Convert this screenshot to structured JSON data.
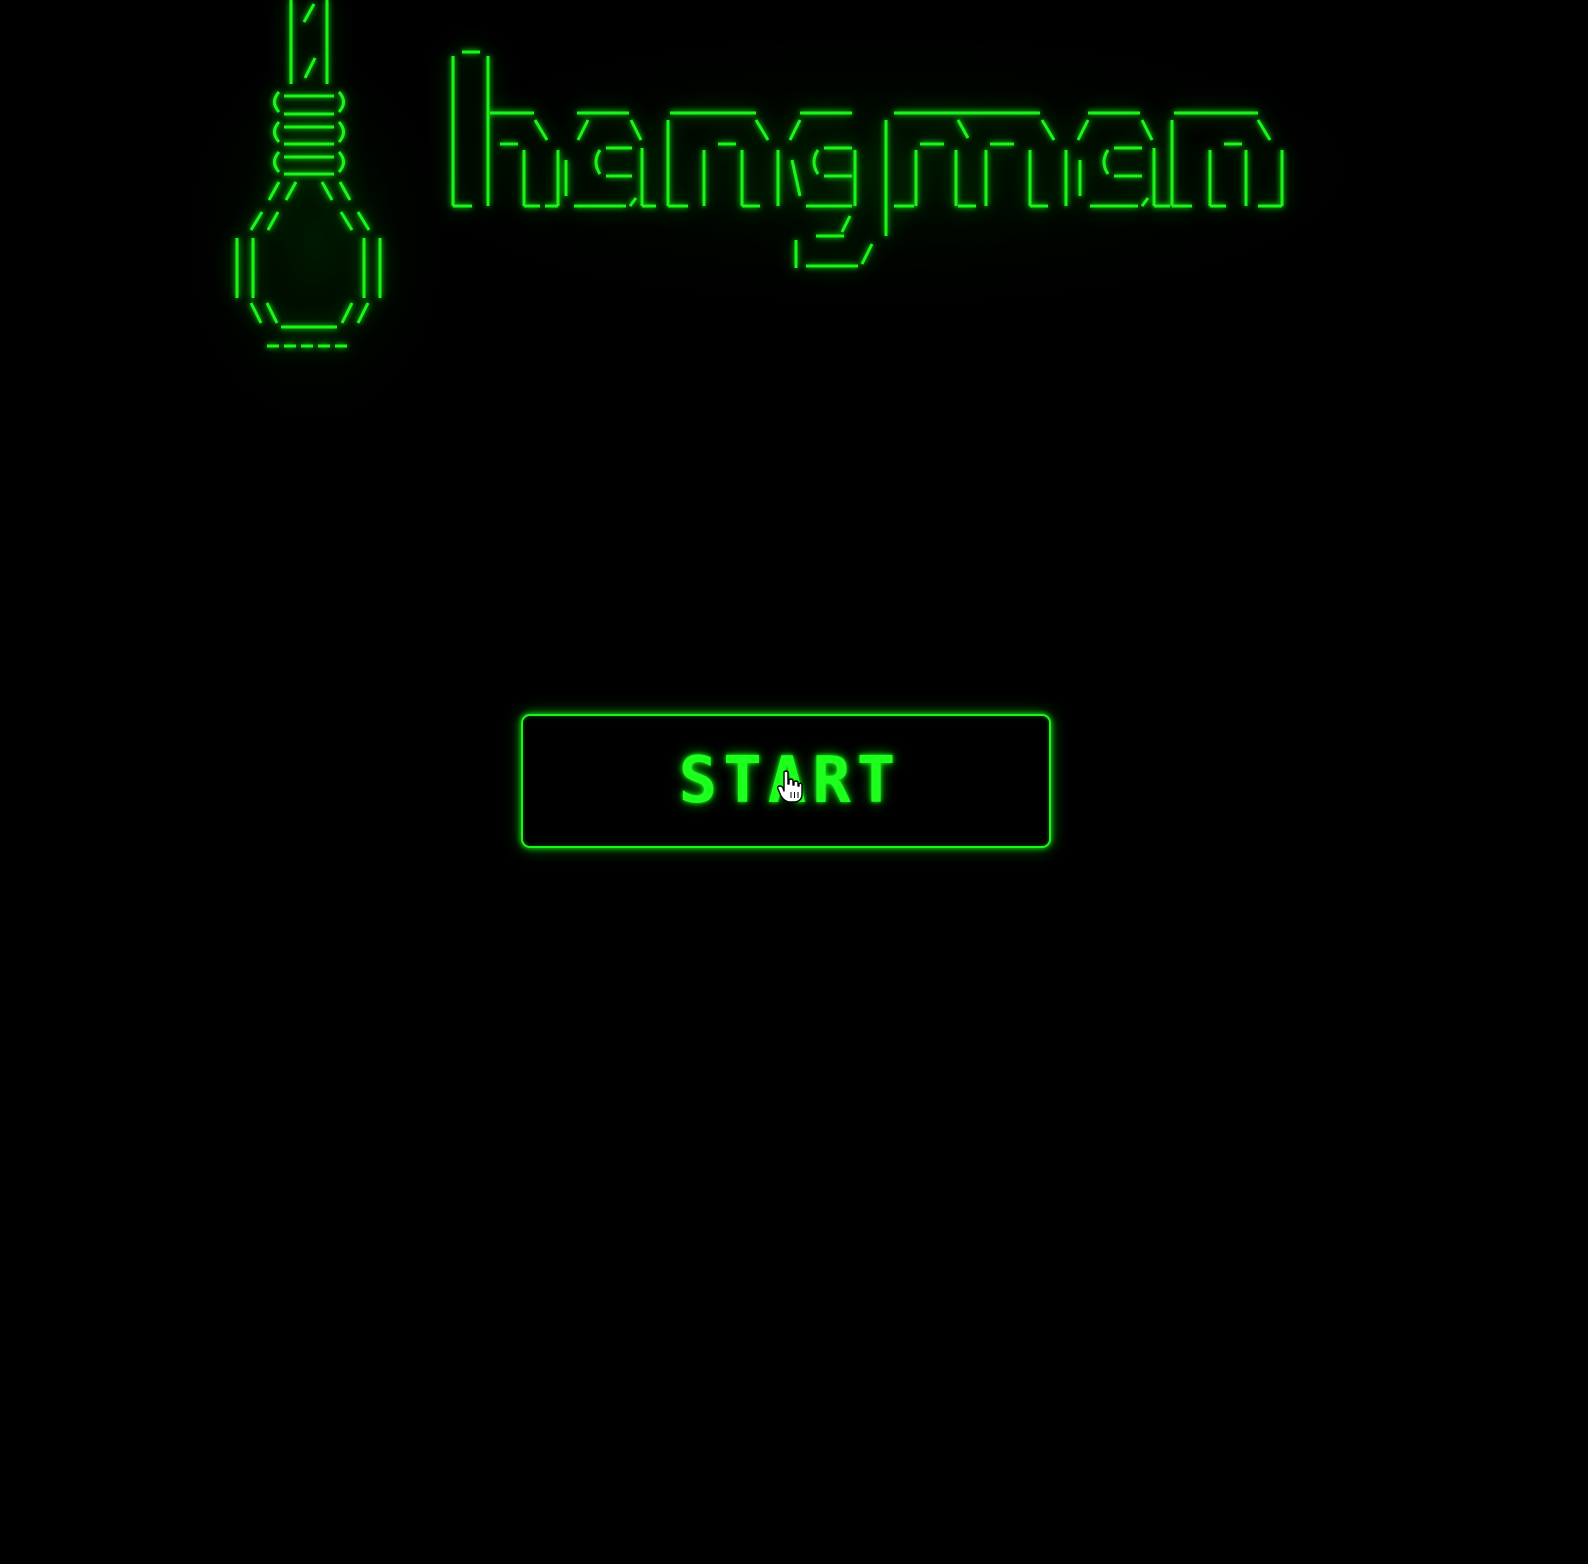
{
  "title": {
    "text": "hangman",
    "logo_icon": "noose-icon",
    "color": "#1cf51c"
  },
  "start_button": {
    "label": "START",
    "color": "#1dff1d"
  },
  "cursor": {
    "icon": "hand-pointer-icon"
  },
  "background_color": "#000000"
}
